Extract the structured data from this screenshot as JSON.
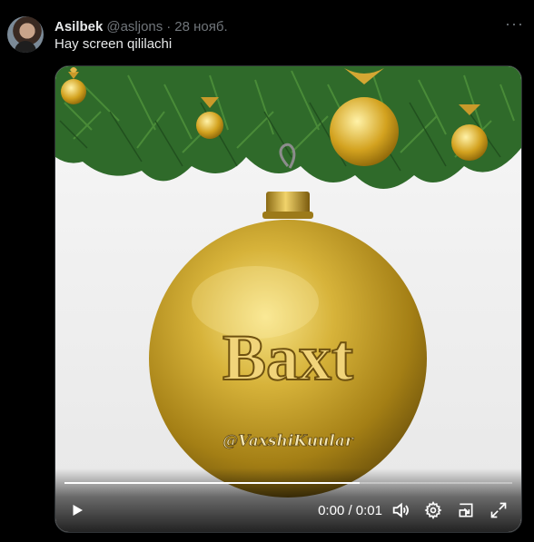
{
  "tweet": {
    "author_name": "Asilbek",
    "handle": "@asljons",
    "separator": "·",
    "date": "28 нояб.",
    "more_icon": "more-horizontal-icon",
    "text": "Hay screen qililachi"
  },
  "video": {
    "ornament_title": "Baxt",
    "ornament_signature": "@VaxshiKuular",
    "time_display": "0:00 / 0:01",
    "progress": 0.66,
    "controls": [
      "play-icon",
      "volume-icon",
      "settings-icon",
      "picture-in-picture-icon",
      "fullscreen-icon"
    ]
  },
  "colors": {
    "background": "#000000",
    "text_primary": "#e7e9ea",
    "text_secondary": "#71767b",
    "ornament_gold": "#c9a227"
  }
}
